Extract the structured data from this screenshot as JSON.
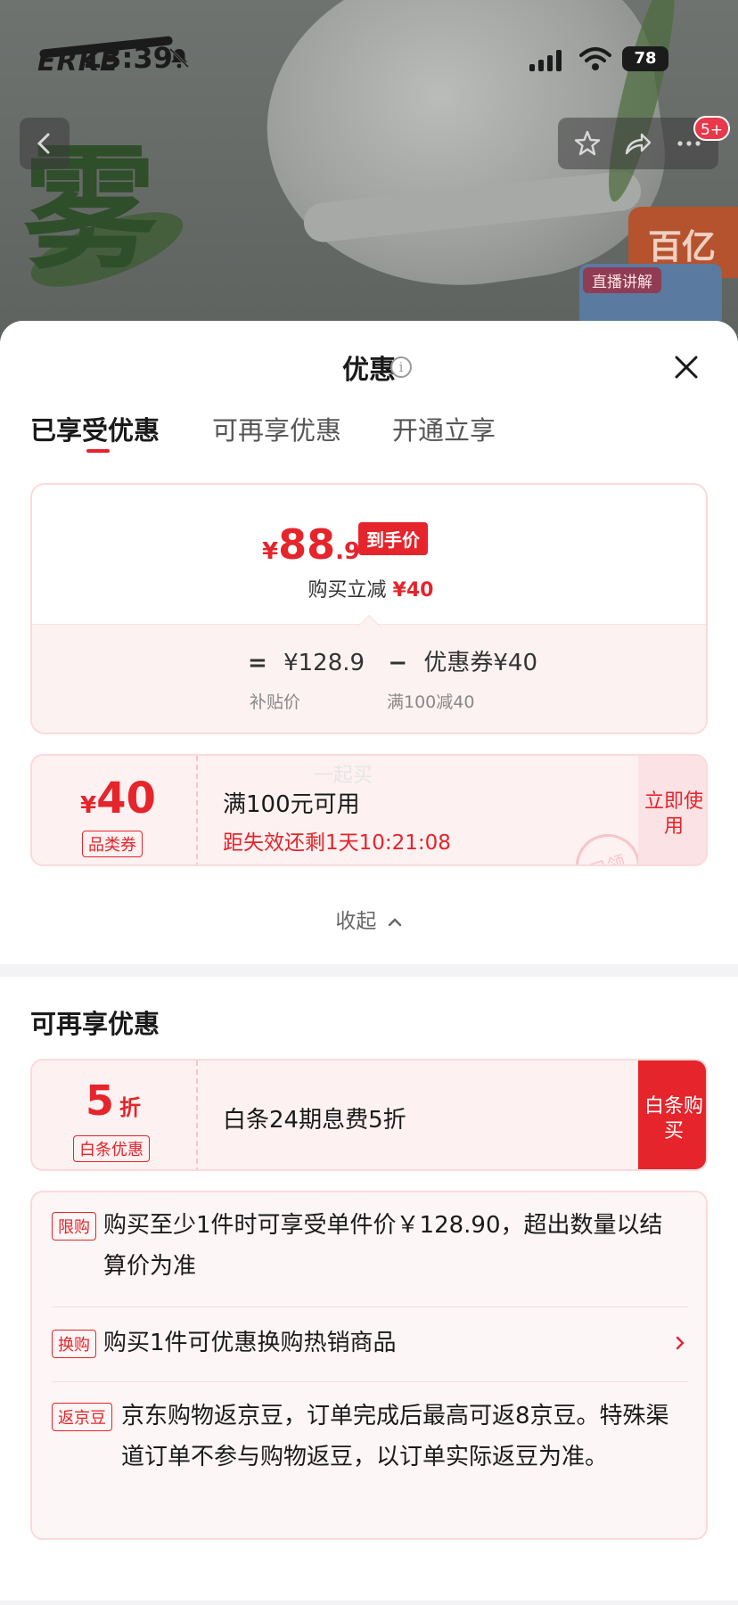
{
  "status_bar": {
    "time": "13:39",
    "battery": "78"
  },
  "background": {
    "brand_logo": "ERKE",
    "poster_char": "雾",
    "live_tag": "直播讲解",
    "promo_text": "百亿",
    "cart_badge": "5+"
  },
  "sheet": {
    "title": "优惠",
    "tabs": [
      "已享受优惠",
      "可再享优惠",
      "开通立享"
    ],
    "active_tab": 0,
    "price_card": {
      "currency": "¥",
      "price_int": "88",
      "price_dec": ".9",
      "price_tag": "到手价",
      "subtitle_prefix": "购买立减",
      "subtitle_amount": "¥40",
      "formula": {
        "eq": "=",
        "original": "¥128.9",
        "minus": "−",
        "coupon": "优惠券¥40"
      },
      "original_label": "补贴价",
      "coupon_label": "满100减40"
    },
    "coupon": {
      "currency": "¥",
      "amount": "40",
      "type": "品类券",
      "condition": "满100元可用",
      "expire": "距失效还剩1天10:21:08",
      "action": "立即使用",
      "stamp": "已领",
      "watermark": "一起买"
    },
    "collapse_label": "收起",
    "more_section": {
      "title": "可再享优惠",
      "baitiao": {
        "discount": "5",
        "unit": "折",
        "type": "白条优惠",
        "desc": "白条24期息费5折",
        "action": "白条购买"
      },
      "rules": [
        {
          "tag": "限购",
          "text": "购买至少1件时可享受单件价￥128.90，超出数量以结算价为准"
        },
        {
          "tag": "换购",
          "text": "购买1件可优惠换购热销商品"
        },
        {
          "tag": "返京豆",
          "text": "京东购物返京豆，订单完成后最高可返8京豆。特殊渠道订单不参与购物返豆，以订单实际返豆为准。"
        }
      ]
    }
  },
  "colors": {
    "accent": "#e5242b",
    "card_border": "#fcd9db",
    "card_bg": "#fdf1f1"
  },
  "icons": [
    "bell-muted-icon",
    "signal-icon",
    "wifi-icon",
    "back-icon",
    "star-icon",
    "share-icon",
    "more-icon",
    "info-icon",
    "close-icon",
    "chevron-up-icon",
    "chevron-right-icon"
  ]
}
